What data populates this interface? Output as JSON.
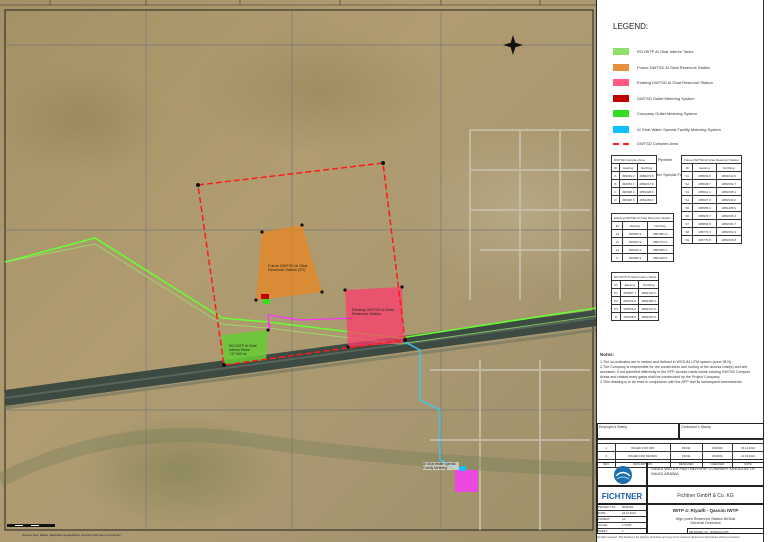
{
  "map": {
    "labels": {
      "future": "Future DWTSD Al Ghat Reservoir Station (ST)",
      "existing": "Existing DWTSD Al Ghat Reservoir Station",
      "ro": "RO-IWTP Al Ghat Interim Tanks",
      "ro_volume": "~37 500 m³",
      "facility": "Al Ghat Water Special Facility Metering",
      "footer": "Source: Esri, Maxar, Earthstar Geographics, and the GIS User Community"
    },
    "colors": {
      "complex": "#ff1a1a",
      "pipeline": "#66ff33",
      "facility_pipe": "#33ccff",
      "future": "#e0882a",
      "existing": "#ff3c6e",
      "ro": "#66cc33"
    }
  },
  "legend": {
    "title": "LEGEND:",
    "items": [
      {
        "label": "RO-IWTP Al Ghat Interim Tanks",
        "color": "#8ee06a",
        "type": "fill"
      },
      {
        "label": "Future DWTSD Al Ghat Reservoir Station",
        "color": "#e8913a",
        "type": "fill"
      },
      {
        "label": "Existing DWTSD Al Ghat Reservoir Station",
        "color": "#ff5a84",
        "type": "fill"
      },
      {
        "label": "DWTSD Outlet Metering System",
        "color": "#c00000",
        "type": "fill"
      },
      {
        "label": "Company Outlet Metering System",
        "color": "#33dd22",
        "type": "fill"
      },
      {
        "label": "Al Ghat Water Special Facility Metering System",
        "color": "#11c0ff",
        "type": "fill"
      },
      {
        "label": "DWTSD Complex Area",
        "color": "#ff2020",
        "type": "dash"
      },
      {
        "label": "IWTP Main Pipeline",
        "color": "#22ee22",
        "type": "line"
      },
      {
        "label": "Al Ghat Water Special Facility Pipeline",
        "color": "#11c0ff",
        "type": "line"
      }
    ]
  },
  "tables": {
    "complex": {
      "title": "DWTSD Complex Area",
      "headers": [
        "ID",
        "Easting",
        "Northing"
      ],
      "rows": [
        [
          "A",
          "495264.2",
          "2882073.5"
        ],
        [
          "B",
          "496353.7",
          "2882017.6"
        ],
        [
          "C",
          "496398.3",
          "2881328.6"
        ],
        [
          "D",
          "495408.6",
          "2881263.6"
        ]
      ]
    },
    "existing": {
      "title": "Existing DWTSD Al Ghat Reservoir Station",
      "headers": [
        "ID",
        "Easting",
        "Northing"
      ],
      "rows": [
        [
          "10",
          "496056.5",
          "2881581.0"
        ],
        [
          "11",
          "496354.9",
          "2881723.2"
        ],
        [
          "12",
          "496102.2",
          "2881385.1"
        ],
        [
          "C",
          "496398.3",
          "2881328.6"
        ]
      ]
    },
    "ro": {
      "title": "RO-IWTP Al Ghat Interim Tanks",
      "headers": [
        "ID",
        "Easting",
        "Northing"
      ],
      "rows": [
        [
          "P1",
          "495387.1",
          "2881432.2"
        ],
        [
          "P2",
          "495434.0",
          "2881405.4"
        ],
        [
          "P3",
          "495656.2",
          "2881370.0"
        ],
        [
          "D",
          "495408.6",
          "2881263.6"
        ]
      ]
    },
    "future": {
      "title": "Future DWTSD Al Ghat Reservoir Station",
      "headers": [
        "ID",
        "Easting",
        "Northing"
      ],
      "rows": [
        [
          "S1",
          "495654.6",
          "2881642.6"
        ],
        [
          "S2",
          "495638.7",
          "2881554.7"
        ],
        [
          "S3",
          "495614.1",
          "2881595.1"
        ],
        [
          "S4",
          "495627.6",
          "2881540.2"
        ],
        [
          "S5",
          "495955.0",
          "2881485.9"
        ],
        [
          "S6",
          "495915.7",
          "2881505.4"
        ],
        [
          "S7",
          "495866.8",
          "2881581.7"
        ],
        [
          "S8",
          "495773.3",
          "2881561.3"
        ],
        [
          "S9",
          "495779.8",
          "2881536.8"
        ]
      ]
    }
  },
  "notes": {
    "title": "Notes:",
    "items": [
      "1.The co-ordinates are in meters and defined in WGS-84 UTM system (zone 38 N).",
      "2.The Company is responsible for the construction and routing of the access road(s) and site accesses, if not specified differently in the RFP. Access roads inside existing DWTSD Complex Areas and related entry gates shall be constructed by the Project Company.",
      "3.This drawing is to be read in conjunction with the RFP and its subsequent amendments."
    ]
  },
  "titleblock": {
    "owner_field": "Employer's Stamp",
    "contractor_field": "Contractor's Stamp",
    "revisions": [
      [
        "1",
        "ISSUED FOR RFP",
        "DS/CE",
        "FKM/MA",
        "18.12.2024"
      ],
      [
        "0",
        "ISSUED FOR REVIEW",
        "DS/CE",
        "FKM/MA",
        "12.03.2024"
      ]
    ],
    "rev_header": [
      "REV",
      "DESCRIPTION",
      "DESIGNED",
      "CHECKED",
      "DATE"
    ],
    "client": "SAUDI WATER PARTNERSHIP COMPANY KINGDOM OF SAUDI ARABIA",
    "consultant_logo": "FICHTNER",
    "consultant": "Fichtner GmbH & Co. KG",
    "project_title": "IWTP 4: Riyadh - Qassim IWTP",
    "drawing_title": "High point Reservoir Station AlGhat General Overview",
    "fields": [
      [
        "PROJECT No.:",
        "8546A04"
      ],
      [
        "DATE:",
        "18.12.2024"
      ],
      [
        "FORMAT:",
        "A3"
      ],
      [
        "SCALE:",
        "1:5,000"
      ],
      [
        "SHEET:",
        "1"
      ]
    ],
    "drawing_no": "DRAWING No.: 8546A04-005",
    "footer": "All rights reserved. This drawing is the property of Fichtner and may not be copied or disclosed to third parties without permission."
  }
}
